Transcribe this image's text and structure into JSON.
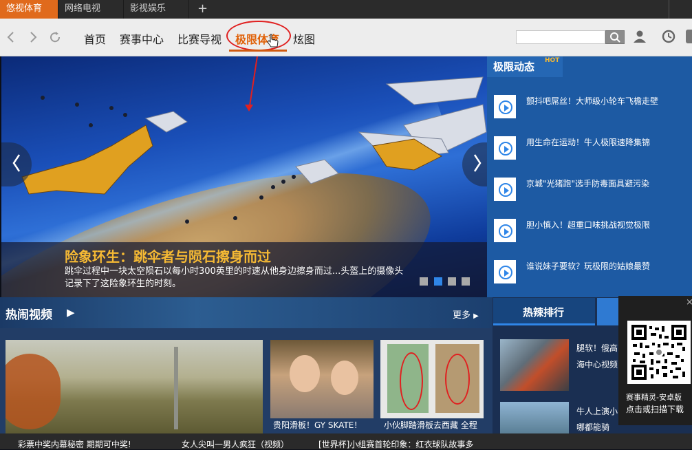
{
  "tabs": [
    {
      "label": "悠视体育",
      "active": true
    },
    {
      "label": "网络电视",
      "active": false
    },
    {
      "label": "影视娱乐",
      "active": false
    }
  ],
  "tab_add": "+",
  "nav": {
    "back_icon": "chevron-left-icon",
    "forward_icon": "chevron-right-icon",
    "refresh_icon": "refresh-icon",
    "menu": [
      "首页",
      "赛事中心",
      "比赛导视",
      "极限体育",
      "炫图"
    ],
    "active_menu": "极限体育",
    "search_placeholder": "",
    "accent": "#e0620a"
  },
  "hero": {
    "title": "险象环生：跳伞者与陨石擦身而过",
    "desc": "跳伞过程中一块太空陨石以每小时300英里的时速从他身边擦身而过...头盔上的摄像头记录下了这险象环生的时刻。",
    "dots": 4,
    "active_dot": 1
  },
  "side": {
    "title": "极限动态",
    "hot": "HOT",
    "items": [
      "颤抖吧屌丝！大师级小轮车飞檐走壁",
      "用生命在运动！牛人极限速降集锦",
      "京城\"光猪跑\"选手防毒面具避污染",
      "胆小慎入！超重口味挑战视觉极限",
      "谁说妹子要软？玩极限的姑娘最赞"
    ]
  },
  "hot_videos": {
    "title": "热闹视频",
    "more": "更多",
    "captions": [
      "贵阳滑板！GY SKATE！",
      "小伙脚踏滑板去西藏 全程"
    ]
  },
  "ranking": {
    "title": "热辣排行",
    "items": [
      "腿软！俄高",
      "海中心视频",
      "牛人上演小",
      "哪都能骑"
    ]
  },
  "qr": {
    "label1": "赛事精灵-安卓版",
    "label2": "点击或扫描下载",
    "close": "×"
  },
  "ticker": [
    "彩票中奖内幕秘密 期期可中奖!",
    "女人尖叫一男人疯狂（视频）",
    "[世界杯]小组赛首轮印象：红衣球队故事多"
  ]
}
